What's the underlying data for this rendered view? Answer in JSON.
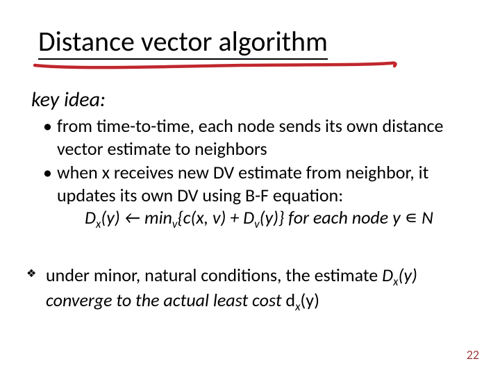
{
  "title": "Distance vector algorithm",
  "subhead": "key idea:",
  "bullets": {
    "b1": "from time-to-time, each node sends its own distance vector estimate to neighbors",
    "b2": "when x receives new DV estimate from neighbor, it updates its own DV using B-F equation:",
    "eq_prefix": "D",
    "eq_sub1": "x",
    "eq_mid1": "(y) ← min",
    "eq_sub2": "v",
    "eq_mid2": "{c(x, v) + D",
    "eq_sub3": "v",
    "eq_mid3": "(y)}  for each node y ",
    "eq_in": "∊",
    "eq_tail": " N"
  },
  "concl": {
    "pre": "under minor, natural conditions, the estimate ",
    "dx": "D",
    "dx_sub": "x",
    "dx_tail": "(y) converge to the actual least cost ",
    "d2": "d",
    "d2_sub": "x",
    "d2_tail": "(y)"
  },
  "slidenum": "22"
}
